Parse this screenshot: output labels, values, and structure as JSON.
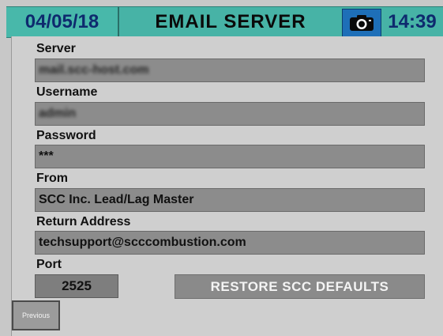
{
  "header": {
    "date": "04/05/18",
    "title": "EMAIL SERVER",
    "time": "14:39",
    "camera_icon": "camera-icon",
    "colors": {
      "bar": "#47b3a6",
      "date_text": "#0e2a6e",
      "camera_bg": "#1e6fb8"
    }
  },
  "fields": {
    "server": {
      "label": "Server",
      "value": "mail.scc-host.com"
    },
    "username": {
      "label": "Username",
      "value": "admin"
    },
    "password": {
      "label": "Password",
      "value": "***"
    },
    "from": {
      "label": "From",
      "value": "SCC Inc. Lead/Lag Master"
    },
    "return_address": {
      "label": "Return Address",
      "value": "techsupport@scccombustion.com"
    },
    "port": {
      "label": "Port",
      "value": "2525"
    }
  },
  "buttons": {
    "restore": "RESTORE SCC DEFAULTS",
    "previous": "Previous"
  }
}
